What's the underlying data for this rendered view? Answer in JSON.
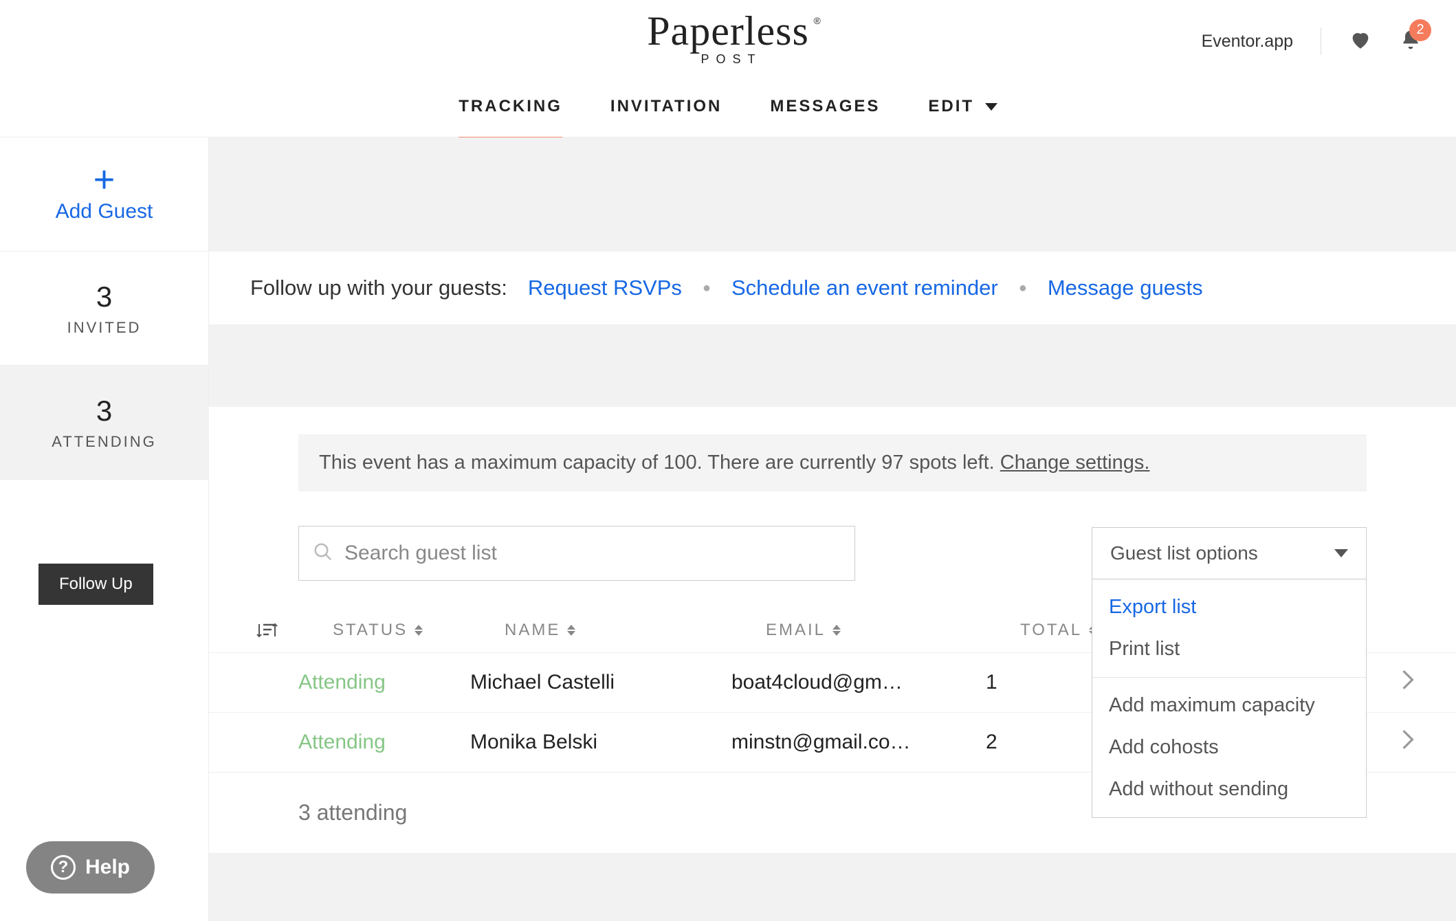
{
  "header": {
    "brand_top": "Paperless",
    "brand_sub": "POST",
    "app_label": "Eventor.app",
    "notif_count": "2"
  },
  "nav": {
    "tracking": "TRACKING",
    "invitation": "INVITATION",
    "messages": "MESSAGES",
    "edit": "EDIT"
  },
  "sidebar": {
    "add_label": "Add Guest",
    "invited_count": "3",
    "invited_label": "INVITED",
    "attending_count": "3",
    "attending_label": "ATTENDING",
    "followup": "Follow Up",
    "help": "Help"
  },
  "followup_bar": {
    "lead": "Follow up with your guests:",
    "link1": "Request RSVPs",
    "link2": "Schedule an event reminder",
    "link3": "Message guests"
  },
  "capacity": {
    "text_a": "This event has a maximum capacity of 100. There are currently 97 spots left. ",
    "change": "Change settings."
  },
  "search": {
    "placeholder": "Search guest list"
  },
  "options": {
    "label": "Guest list options",
    "export": "Export list",
    "print": "Print list",
    "capacity": "Add maximum capacity",
    "cohosts": "Add cohosts",
    "nosend": "Add without sending"
  },
  "table": {
    "headers": {
      "status": "STATUS",
      "name": "NAME",
      "email": "EMAIL",
      "total": "TOTAL"
    },
    "rows": [
      {
        "status": "Attending",
        "name": "Michael Castelli",
        "email": "boat4cloud@gm…",
        "total": "1"
      },
      {
        "status": "Attending",
        "name": "Monika Belski",
        "email": "minstn@gmail.co…",
        "total": "2"
      }
    ],
    "summary": "3 attending"
  }
}
